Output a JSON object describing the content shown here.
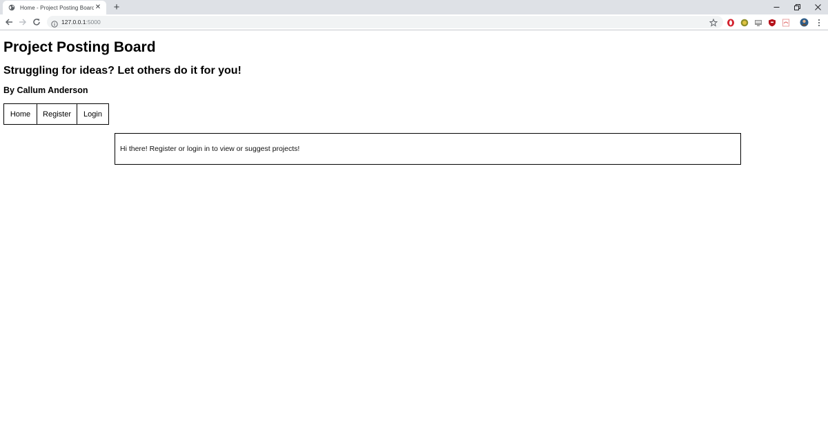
{
  "browser": {
    "tab": {
      "title": "Home - Project Posting Board"
    },
    "address_bar": {
      "host": "127.0.0.1",
      "port": ":5000"
    },
    "window_controls": [
      "minimize",
      "restore",
      "close"
    ]
  },
  "page": {
    "title": "Project Posting Board",
    "subtitle": "Struggling for ideas? Let others do it for you!",
    "author": "By Callum Anderson",
    "nav": {
      "home": "Home",
      "register": "Register",
      "login": "Login"
    },
    "message": "Hi there! Register or login in to view or suggest projects!"
  },
  "colors": {
    "tabstrip": "#dee1e6",
    "omnibox": "#f1f3f4",
    "border": "#000000"
  }
}
